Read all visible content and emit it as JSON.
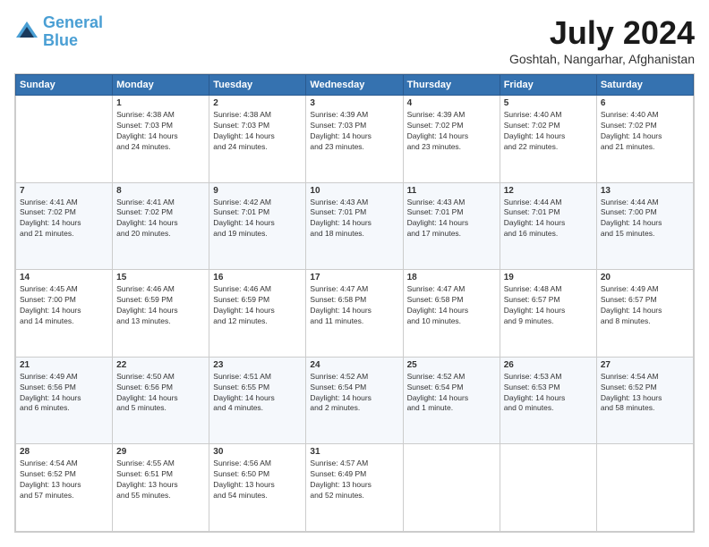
{
  "header": {
    "logo_line1": "General",
    "logo_line2": "Blue",
    "month": "July 2024",
    "location": "Goshtah, Nangarhar, Afghanistan"
  },
  "days_of_week": [
    "Sunday",
    "Monday",
    "Tuesday",
    "Wednesday",
    "Thursday",
    "Friday",
    "Saturday"
  ],
  "weeks": [
    [
      {
        "day": "",
        "sunrise": "",
        "sunset": "",
        "daylight": ""
      },
      {
        "day": "1",
        "sunrise": "Sunrise: 4:38 AM",
        "sunset": "Sunset: 7:03 PM",
        "daylight": "Daylight: 14 hours and 24 minutes."
      },
      {
        "day": "2",
        "sunrise": "Sunrise: 4:38 AM",
        "sunset": "Sunset: 7:03 PM",
        "daylight": "Daylight: 14 hours and 24 minutes."
      },
      {
        "day": "3",
        "sunrise": "Sunrise: 4:39 AM",
        "sunset": "Sunset: 7:03 PM",
        "daylight": "Daylight: 14 hours and 23 minutes."
      },
      {
        "day": "4",
        "sunrise": "Sunrise: 4:39 AM",
        "sunset": "Sunset: 7:02 PM",
        "daylight": "Daylight: 14 hours and 23 minutes."
      },
      {
        "day": "5",
        "sunrise": "Sunrise: 4:40 AM",
        "sunset": "Sunset: 7:02 PM",
        "daylight": "Daylight: 14 hours and 22 minutes."
      },
      {
        "day": "6",
        "sunrise": "Sunrise: 4:40 AM",
        "sunset": "Sunset: 7:02 PM",
        "daylight": "Daylight: 14 hours and 21 minutes."
      }
    ],
    [
      {
        "day": "7",
        "sunrise": "Sunrise: 4:41 AM",
        "sunset": "Sunset: 7:02 PM",
        "daylight": "Daylight: 14 hours and 21 minutes."
      },
      {
        "day": "8",
        "sunrise": "Sunrise: 4:41 AM",
        "sunset": "Sunset: 7:02 PM",
        "daylight": "Daylight: 14 hours and 20 minutes."
      },
      {
        "day": "9",
        "sunrise": "Sunrise: 4:42 AM",
        "sunset": "Sunset: 7:01 PM",
        "daylight": "Daylight: 14 hours and 19 minutes."
      },
      {
        "day": "10",
        "sunrise": "Sunrise: 4:43 AM",
        "sunset": "Sunset: 7:01 PM",
        "daylight": "Daylight: 14 hours and 18 minutes."
      },
      {
        "day": "11",
        "sunrise": "Sunrise: 4:43 AM",
        "sunset": "Sunset: 7:01 PM",
        "daylight": "Daylight: 14 hours and 17 minutes."
      },
      {
        "day": "12",
        "sunrise": "Sunrise: 4:44 AM",
        "sunset": "Sunset: 7:01 PM",
        "daylight": "Daylight: 14 hours and 16 minutes."
      },
      {
        "day": "13",
        "sunrise": "Sunrise: 4:44 AM",
        "sunset": "Sunset: 7:00 PM",
        "daylight": "Daylight: 14 hours and 15 minutes."
      }
    ],
    [
      {
        "day": "14",
        "sunrise": "Sunrise: 4:45 AM",
        "sunset": "Sunset: 7:00 PM",
        "daylight": "Daylight: 14 hours and 14 minutes."
      },
      {
        "day": "15",
        "sunrise": "Sunrise: 4:46 AM",
        "sunset": "Sunset: 6:59 PM",
        "daylight": "Daylight: 14 hours and 13 minutes."
      },
      {
        "day": "16",
        "sunrise": "Sunrise: 4:46 AM",
        "sunset": "Sunset: 6:59 PM",
        "daylight": "Daylight: 14 hours and 12 minutes."
      },
      {
        "day": "17",
        "sunrise": "Sunrise: 4:47 AM",
        "sunset": "Sunset: 6:58 PM",
        "daylight": "Daylight: 14 hours and 11 minutes."
      },
      {
        "day": "18",
        "sunrise": "Sunrise: 4:47 AM",
        "sunset": "Sunset: 6:58 PM",
        "daylight": "Daylight: 14 hours and 10 minutes."
      },
      {
        "day": "19",
        "sunrise": "Sunrise: 4:48 AM",
        "sunset": "Sunset: 6:57 PM",
        "daylight": "Daylight: 14 hours and 9 minutes."
      },
      {
        "day": "20",
        "sunrise": "Sunrise: 4:49 AM",
        "sunset": "Sunset: 6:57 PM",
        "daylight": "Daylight: 14 hours and 8 minutes."
      }
    ],
    [
      {
        "day": "21",
        "sunrise": "Sunrise: 4:49 AM",
        "sunset": "Sunset: 6:56 PM",
        "daylight": "Daylight: 14 hours and 6 minutes."
      },
      {
        "day": "22",
        "sunrise": "Sunrise: 4:50 AM",
        "sunset": "Sunset: 6:56 PM",
        "daylight": "Daylight: 14 hours and 5 minutes."
      },
      {
        "day": "23",
        "sunrise": "Sunrise: 4:51 AM",
        "sunset": "Sunset: 6:55 PM",
        "daylight": "Daylight: 14 hours and 4 minutes."
      },
      {
        "day": "24",
        "sunrise": "Sunrise: 4:52 AM",
        "sunset": "Sunset: 6:54 PM",
        "daylight": "Daylight: 14 hours and 2 minutes."
      },
      {
        "day": "25",
        "sunrise": "Sunrise: 4:52 AM",
        "sunset": "Sunset: 6:54 PM",
        "daylight": "Daylight: 14 hours and 1 minute."
      },
      {
        "day": "26",
        "sunrise": "Sunrise: 4:53 AM",
        "sunset": "Sunset: 6:53 PM",
        "daylight": "Daylight: 14 hours and 0 minutes."
      },
      {
        "day": "27",
        "sunrise": "Sunrise: 4:54 AM",
        "sunset": "Sunset: 6:52 PM",
        "daylight": "Daylight: 13 hours and 58 minutes."
      }
    ],
    [
      {
        "day": "28",
        "sunrise": "Sunrise: 4:54 AM",
        "sunset": "Sunset: 6:52 PM",
        "daylight": "Daylight: 13 hours and 57 minutes."
      },
      {
        "day": "29",
        "sunrise": "Sunrise: 4:55 AM",
        "sunset": "Sunset: 6:51 PM",
        "daylight": "Daylight: 13 hours and 55 minutes."
      },
      {
        "day": "30",
        "sunrise": "Sunrise: 4:56 AM",
        "sunset": "Sunset: 6:50 PM",
        "daylight": "Daylight: 13 hours and 54 minutes."
      },
      {
        "day": "31",
        "sunrise": "Sunrise: 4:57 AM",
        "sunset": "Sunset: 6:49 PM",
        "daylight": "Daylight: 13 hours and 52 minutes."
      },
      {
        "day": "",
        "sunrise": "",
        "sunset": "",
        "daylight": ""
      },
      {
        "day": "",
        "sunrise": "",
        "sunset": "",
        "daylight": ""
      },
      {
        "day": "",
        "sunrise": "",
        "sunset": "",
        "daylight": ""
      }
    ]
  ]
}
